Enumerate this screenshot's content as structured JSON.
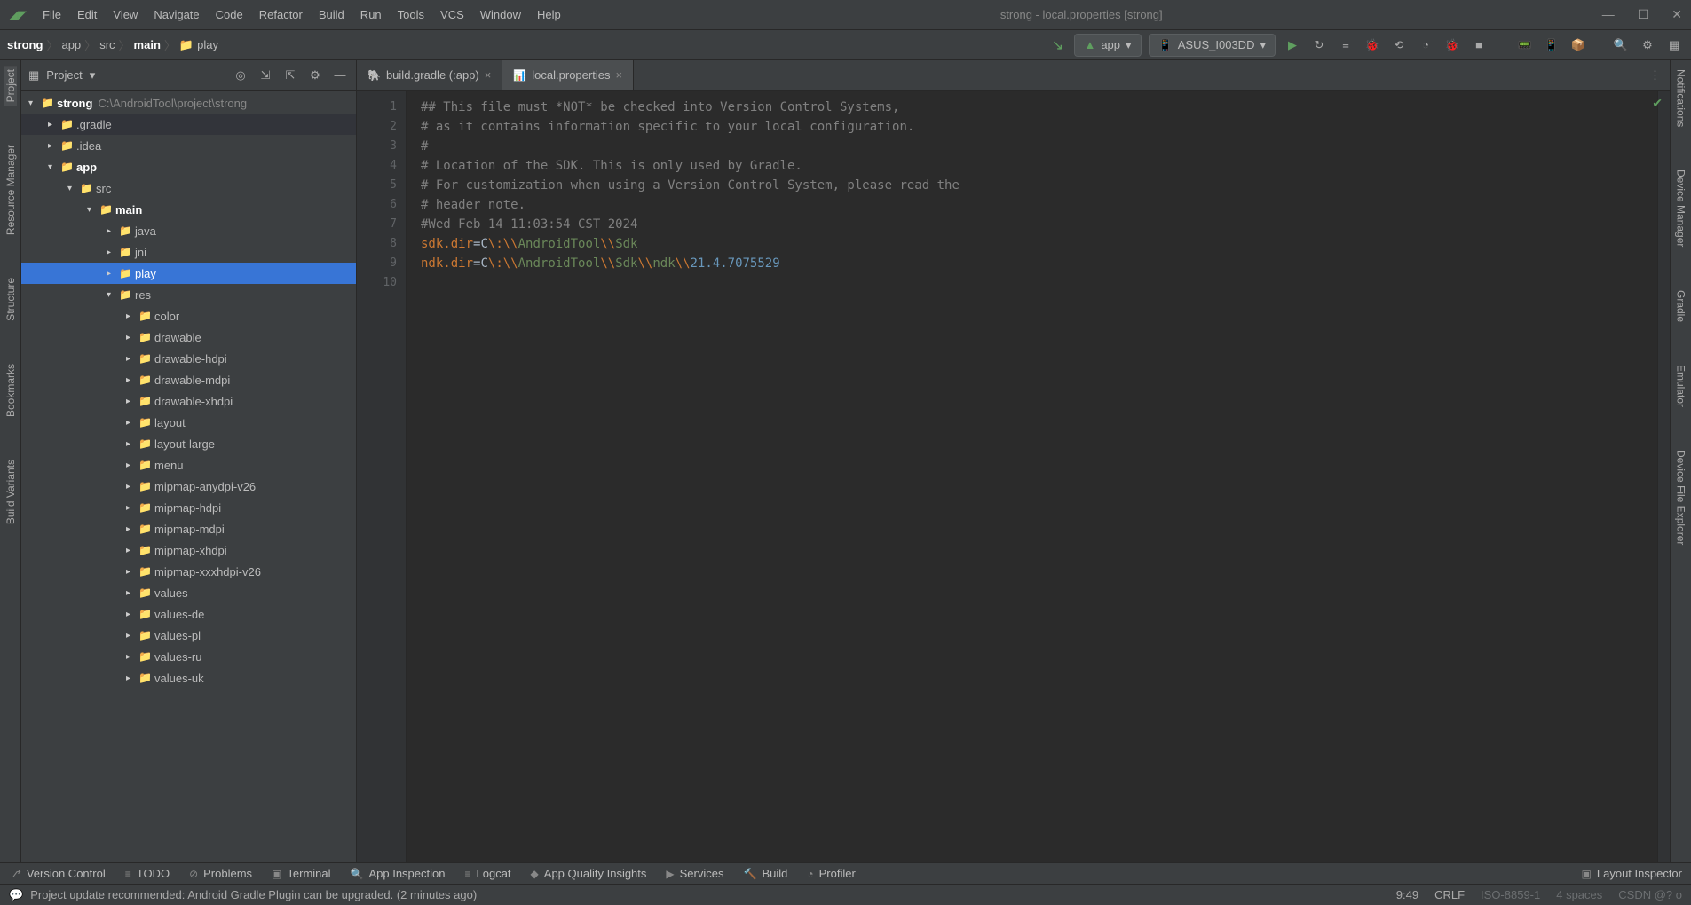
{
  "window": {
    "title": "strong - local.properties [strong]",
    "menu": [
      "File",
      "Edit",
      "View",
      "Navigate",
      "Code",
      "Refactor",
      "Build",
      "Run",
      "Tools",
      "VCS",
      "Window",
      "Help"
    ]
  },
  "breadcrumb": [
    "strong",
    "app",
    "src",
    "main",
    "play"
  ],
  "runConfig": {
    "module": "app",
    "device": "ASUS_I003DD"
  },
  "projectPanel": {
    "title": "Project"
  },
  "tree": {
    "root": {
      "name": "strong",
      "path": "C:\\AndroidTool\\project\\strong"
    },
    "items": [
      {
        "level": 1,
        "expander": "▸",
        "name": ".gradle",
        "bold": false,
        "color": "brown",
        "dark": true
      },
      {
        "level": 1,
        "expander": "▸",
        "name": ".idea",
        "bold": false,
        "color": "brown"
      },
      {
        "level": 1,
        "expander": "▾",
        "name": "app",
        "bold": true,
        "color": "module"
      },
      {
        "level": 2,
        "expander": "▾",
        "name": "src",
        "bold": false,
        "color": "grey"
      },
      {
        "level": 3,
        "expander": "▾",
        "name": "main",
        "bold": true,
        "color": "module"
      },
      {
        "level": 4,
        "expander": "▸",
        "name": "java",
        "bold": false,
        "color": "grey"
      },
      {
        "level": 4,
        "expander": "▸",
        "name": "jni",
        "bold": false,
        "color": "grey"
      },
      {
        "level": 4,
        "expander": "▸",
        "name": "play",
        "bold": false,
        "color": "grey",
        "selected": true
      },
      {
        "level": 4,
        "expander": "▾",
        "name": "res",
        "bold": false,
        "color": "res"
      },
      {
        "level": 5,
        "expander": "▸",
        "name": "color",
        "bold": false,
        "color": "grey"
      },
      {
        "level": 5,
        "expander": "▸",
        "name": "drawable",
        "bold": false,
        "color": "grey"
      },
      {
        "level": 5,
        "expander": "▸",
        "name": "drawable-hdpi",
        "bold": false,
        "color": "grey"
      },
      {
        "level": 5,
        "expander": "▸",
        "name": "drawable-mdpi",
        "bold": false,
        "color": "grey"
      },
      {
        "level": 5,
        "expander": "▸",
        "name": "drawable-xhdpi",
        "bold": false,
        "color": "grey"
      },
      {
        "level": 5,
        "expander": "▸",
        "name": "layout",
        "bold": false,
        "color": "grey"
      },
      {
        "level": 5,
        "expander": "▸",
        "name": "layout-large",
        "bold": false,
        "color": "grey"
      },
      {
        "level": 5,
        "expander": "▸",
        "name": "menu",
        "bold": false,
        "color": "grey"
      },
      {
        "level": 5,
        "expander": "▸",
        "name": "mipmap-anydpi-v26",
        "bold": false,
        "color": "grey"
      },
      {
        "level": 5,
        "expander": "▸",
        "name": "mipmap-hdpi",
        "bold": false,
        "color": "grey"
      },
      {
        "level": 5,
        "expander": "▸",
        "name": "mipmap-mdpi",
        "bold": false,
        "color": "grey"
      },
      {
        "level": 5,
        "expander": "▸",
        "name": "mipmap-xhdpi",
        "bold": false,
        "color": "grey"
      },
      {
        "level": 5,
        "expander": "▸",
        "name": "mipmap-xxxhdpi-v26",
        "bold": false,
        "color": "grey"
      },
      {
        "level": 5,
        "expander": "▸",
        "name": "values",
        "bold": false,
        "color": "grey"
      },
      {
        "level": 5,
        "expander": "▸",
        "name": "values-de",
        "bold": false,
        "color": "grey"
      },
      {
        "level": 5,
        "expander": "▸",
        "name": "values-pl",
        "bold": false,
        "color": "grey"
      },
      {
        "level": 5,
        "expander": "▸",
        "name": "values-ru",
        "bold": false,
        "color": "grey"
      },
      {
        "level": 5,
        "expander": "▸",
        "name": "values-uk",
        "bold": false,
        "color": "grey"
      }
    ]
  },
  "tabs": [
    {
      "name": "build.gradle (:app)",
      "active": false,
      "icon": "🐘"
    },
    {
      "name": "local.properties",
      "active": true,
      "icon": "📊"
    }
  ],
  "editor": {
    "lines": [
      {
        "n": 1,
        "t": "comment",
        "text": "## This file must *NOT* be checked into Version Control Systems,"
      },
      {
        "n": 2,
        "t": "comment",
        "text": "# as it contains information specific to your local configuration."
      },
      {
        "n": 3,
        "t": "comment",
        "text": "#"
      },
      {
        "n": 4,
        "t": "comment",
        "text": "# Location of the SDK. This is only used by Gradle."
      },
      {
        "n": 5,
        "t": "comment",
        "text": "# For customization when using a Version Control System, please read the"
      },
      {
        "n": 6,
        "t": "comment",
        "text": "# header note."
      },
      {
        "n": 7,
        "t": "comment",
        "text": "#Wed Feb 14 11:03:54 CST 2024"
      },
      {
        "n": 8,
        "t": "prop",
        "key": "sdk.dir",
        "parts": [
          [
            "eq",
            "="
          ],
          [
            "val",
            "C"
          ],
          [
            "esc",
            "\\:\\\\"
          ],
          [
            "path",
            "AndroidTool"
          ],
          [
            "esc",
            "\\\\"
          ],
          [
            "path",
            "Sdk"
          ]
        ]
      },
      {
        "n": 9,
        "t": "prop",
        "key": "ndk.dir",
        "parts": [
          [
            "eq",
            "="
          ],
          [
            "val",
            "C"
          ],
          [
            "esc",
            "\\:\\\\"
          ],
          [
            "path",
            "AndroidTool"
          ],
          [
            "esc",
            "\\\\"
          ],
          [
            "path",
            "Sdk"
          ],
          [
            "esc",
            "\\\\"
          ],
          [
            "path",
            "ndk"
          ],
          [
            "esc",
            "\\\\"
          ],
          [
            "num",
            "21.4.7075529"
          ]
        ]
      },
      {
        "n": 10,
        "t": "blank",
        "text": ""
      }
    ]
  },
  "leftRail": [
    "Project",
    "Resource Manager",
    "Structure",
    "Bookmarks",
    "Build Variants"
  ],
  "rightRail": [
    "Notifications",
    "Device Manager",
    "Gradle",
    "Emulator",
    "Device File Explorer"
  ],
  "bottomBar": [
    "Version Control",
    "TODO",
    "Problems",
    "Terminal",
    "App Inspection",
    "Logcat",
    "App Quality Insights",
    "Services",
    "Build",
    "Profiler"
  ],
  "bottomBarRight": "Layout Inspector",
  "status": {
    "msg": "Project update recommended: Android Gradle Plugin can be upgraded. (2 minutes ago)",
    "pos": "9:49",
    "eol": "CRLF",
    "enc": "ISO-8859-1",
    "indent": "4 spaces",
    "extra": "CSDN @? o"
  }
}
